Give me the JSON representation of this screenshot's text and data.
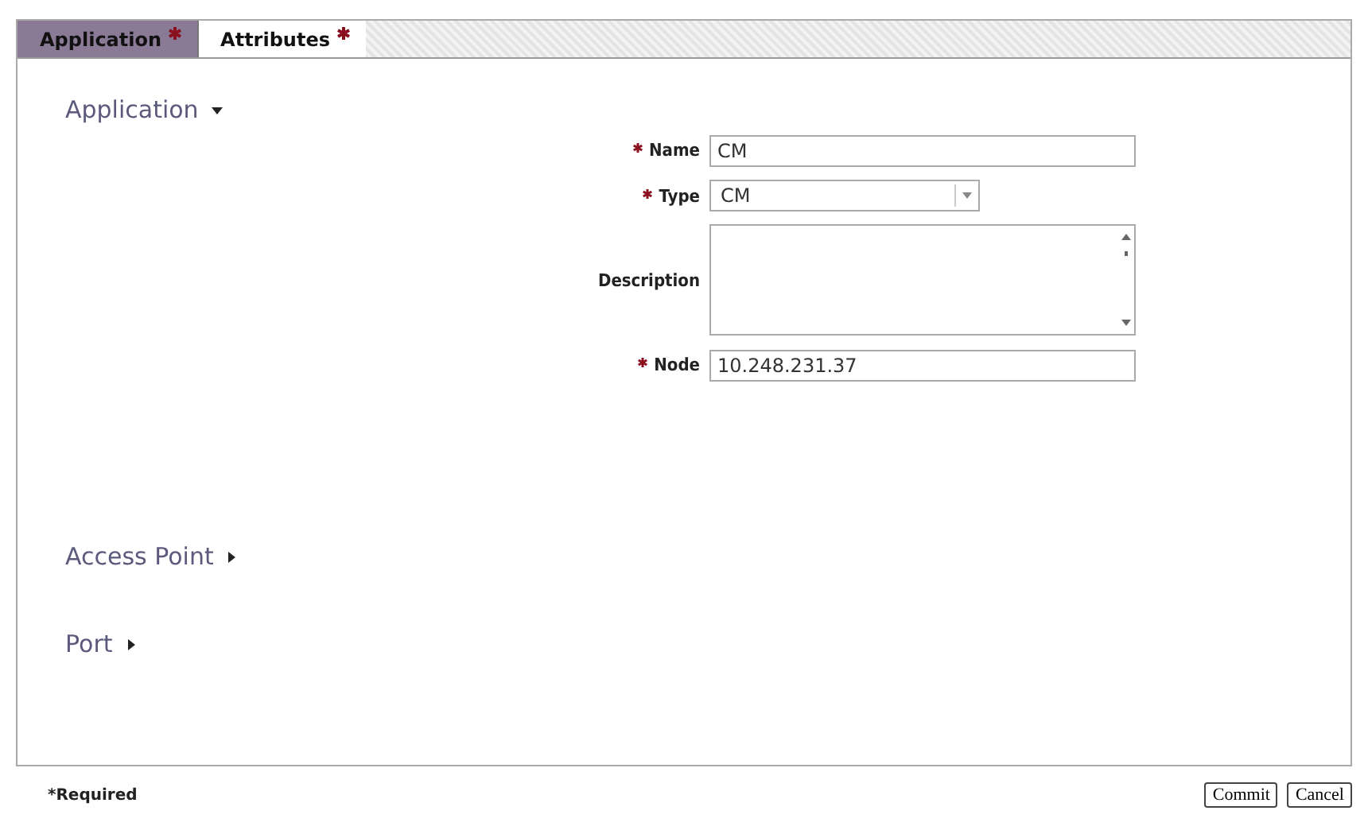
{
  "tabs": [
    {
      "label": "Application",
      "selected": true,
      "required": true
    },
    {
      "label": "Attributes",
      "selected": false,
      "required": true
    }
  ],
  "sections": [
    {
      "title": "Application",
      "expanded": true,
      "fields": [
        {
          "kind": "text",
          "label": "Name",
          "required": true,
          "value": "CM"
        },
        {
          "kind": "select",
          "label": "Type",
          "required": true,
          "value": "CM"
        },
        {
          "kind": "textarea",
          "label": "Description",
          "required": false
        },
        {
          "kind": "text",
          "label": "Node",
          "required": true,
          "value": "10.248.231.37"
        }
      ]
    },
    {
      "title": "Access Point",
      "expanded": false
    },
    {
      "title": "Port",
      "expanded": false
    }
  ],
  "footer": {
    "note": "*Required",
    "buttons": [
      "Commit",
      "Cancel"
    ]
  }
}
